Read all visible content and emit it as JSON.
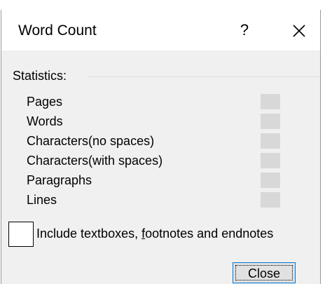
{
  "dialog": {
    "title": "Word Count",
    "help_label": "?",
    "close_icon": "close-x-icon"
  },
  "statistics": {
    "group_label": "Statistics:",
    "rows": [
      {
        "label": "Pages",
        "value": ""
      },
      {
        "label": "Words",
        "value": ""
      },
      {
        "label": "Characters(no spaces)",
        "value": ""
      },
      {
        "label": "Characters(with spaces)",
        "value": ""
      },
      {
        "label": "Paragraphs",
        "value": ""
      },
      {
        "label": "Lines",
        "value": ""
      }
    ]
  },
  "include_option": {
    "label_before": "Include textboxes, ",
    "label_underlined": "f",
    "label_after": "ootnotes and endnotes",
    "checked": false
  },
  "buttons": {
    "close_label": "Close"
  },
  "colors": {
    "background": "#f0f0f0",
    "titlebar": "#ffffff",
    "value_box": "#d8d8d8",
    "button_border": "#0078d7",
    "button_face": "#e1e1e1"
  }
}
